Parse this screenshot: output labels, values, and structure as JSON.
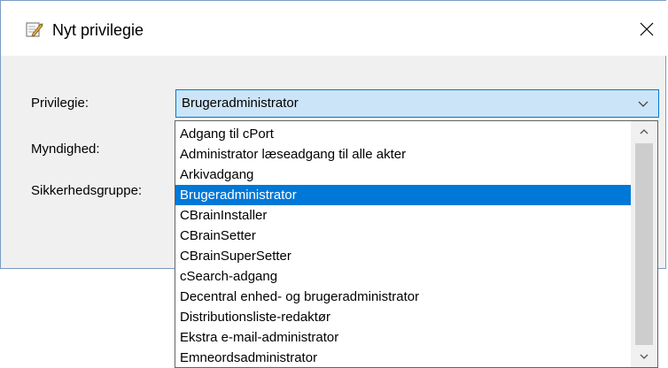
{
  "window": {
    "title": "Nyt privilegie",
    "title_icon": "edit-icon",
    "close_glyph": "✕"
  },
  "form": {
    "privilege_label": "Privilegie:",
    "authority_label": "Myndighed:",
    "security_group_label": "Sikkerhedsgruppe:",
    "privilege_value": "Brugeradministrator"
  },
  "dropdown": {
    "items": [
      "Adgang til cPort",
      "Administrator læseadgang til alle akter",
      "Arkivadgang",
      "Brugeradministrator",
      "CBrainInstaller",
      "CBrainSetter",
      "CBrainSuperSetter",
      "cSearch-adgang",
      "Decentral enhed- og brugeradministrator",
      "Distributionsliste-redaktør",
      "Ekstra e-mail-administrator",
      "Emneordsadministrator"
    ],
    "selected_index": 3
  },
  "colors": {
    "accent": "#0078d7",
    "select_bg": "#cce4f7",
    "dialog_bg": "#f0f0f0"
  }
}
